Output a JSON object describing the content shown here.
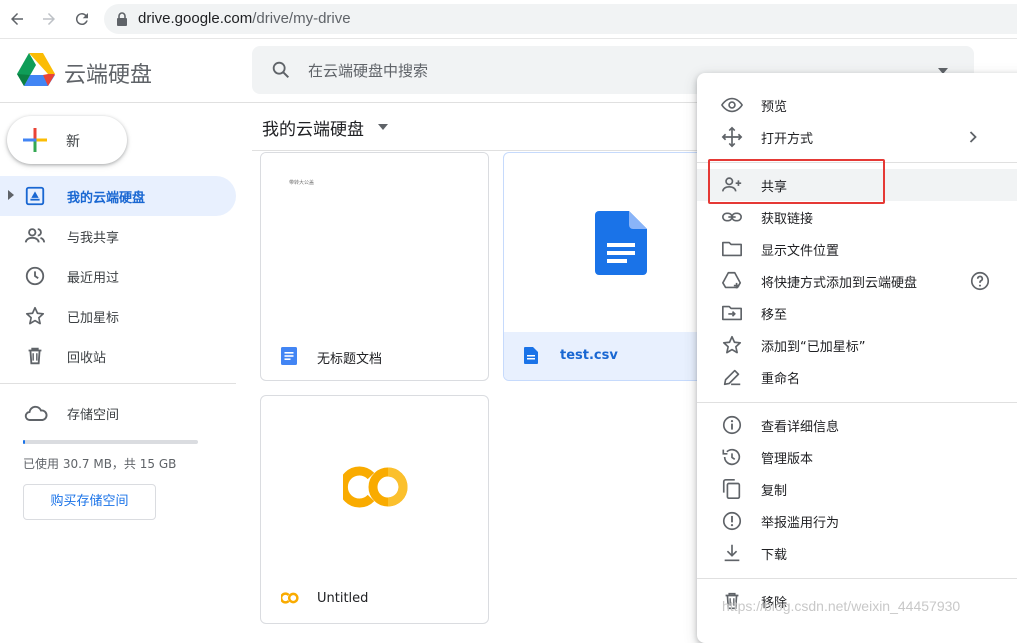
{
  "browser": {
    "url_host": "drive.google.com",
    "url_path": "/drive/my-drive"
  },
  "header": {
    "app_title": "云端硬盘",
    "search_placeholder": "在云端硬盘中搜索"
  },
  "sidebar": {
    "new_label": "新",
    "items": [
      {
        "label": "我的云端硬盘",
        "icon": "my-drive-icon",
        "active": true
      },
      {
        "label": "与我共享",
        "icon": "shared-people-icon"
      },
      {
        "label": "最近用过",
        "icon": "clock-icon"
      },
      {
        "label": "已加星标",
        "icon": "star-icon"
      },
      {
        "label": "回收站",
        "icon": "trash-icon"
      }
    ],
    "storage": {
      "label": "存储空间",
      "usage_text": "已使用 30.7 MB，共 15 GB",
      "used_fraction": 0.002,
      "buy_label": "购买存储空间"
    }
  },
  "main": {
    "breadcrumb": "我的云端硬盘",
    "files": [
      {
        "name": "无标题文档",
        "type": "google-doc",
        "thumb_text": "带转大公盖"
      },
      {
        "name": "test.csv",
        "type": "document",
        "selected": true
      },
      {
        "name": "Untitled",
        "type": "colab"
      }
    ]
  },
  "context_menu": {
    "items": [
      {
        "label": "预览",
        "icon": "eye-icon"
      },
      {
        "label": "打开方式",
        "icon": "move-arrows-icon",
        "submenu": true
      },
      {
        "label": "共享",
        "icon": "person-add-icon",
        "highlighted": true
      },
      {
        "label": "获取链接",
        "icon": "link-icon"
      },
      {
        "label": "显示文件位置",
        "icon": "folder-icon"
      },
      {
        "label": "将快捷方式添加到云端硬盘",
        "icon": "add-shortcut-icon",
        "help": true
      },
      {
        "label": "移至",
        "icon": "move-to-folder-icon"
      },
      {
        "label": "添加到“已加星标”",
        "icon": "star-icon"
      },
      {
        "label": "重命名",
        "icon": "pencil-icon"
      },
      {
        "label": "查看详细信息",
        "icon": "info-icon"
      },
      {
        "label": "管理版本",
        "icon": "history-icon"
      },
      {
        "label": "复制",
        "icon": "copy-icon"
      },
      {
        "label": "举报滥用行为",
        "icon": "report-icon"
      },
      {
        "label": "下载",
        "icon": "download-icon"
      },
      {
        "label": "移除",
        "icon": "trash-icon"
      }
    ]
  },
  "watermark": "https://blog.csdn.net/weixin_44457930",
  "colors": {
    "accent": "#1a73e8",
    "active_bg": "#e8f0fe",
    "highlight_box": "#e53935"
  }
}
